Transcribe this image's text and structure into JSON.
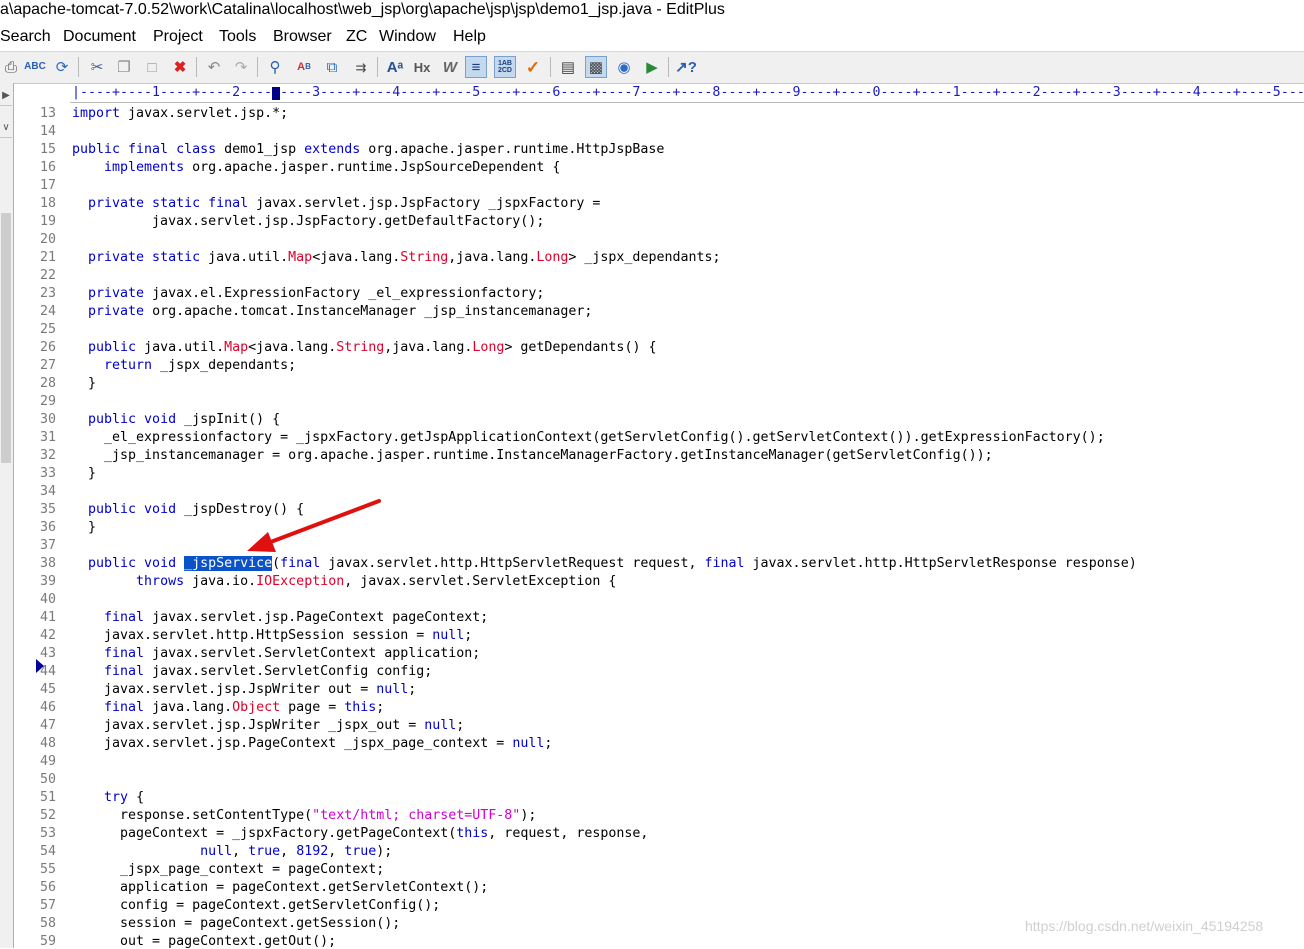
{
  "window": {
    "title": "a\\apache-tomcat-7.0.52\\work\\Catalina\\localhost\\web_jsp\\org\\apache\\jsp\\jsp\\demo1_jsp.java - EditPlus"
  },
  "menu": [
    "Search",
    "Document",
    "Project",
    "Tools",
    "Browser",
    "ZC",
    "Window",
    "Help"
  ],
  "toolbar": {
    "icons": [
      "print-icon",
      "spellcheck-icon",
      "refresh-icon",
      "cut-icon",
      "copy-icon",
      "paste-icon",
      "delete-icon",
      "undo-icon",
      "redo-icon",
      "find-icon",
      "replace-icon",
      "find-in-files-icon",
      "goto-line-icon",
      "font-icon",
      "hex-icon",
      "word-wrap-icon",
      "line-numbers-icon",
      "column-select-icon",
      "spellcheck-tick-icon",
      "fullscreen-icon",
      "output-window-icon",
      "browser-icon",
      "run-icon",
      "help-icon"
    ],
    "colors": {
      "accent": "#0a52c8",
      "keyword": "#0000cc",
      "type_highlight": "#e0002a",
      "string": "#d400d4",
      "line_number": "#7a7a7a"
    }
  },
  "ruler": {
    "text": "|----+----1----+----2----+----3----+----4----+----5----+----6----+----7----+----8----+----9----+----0----+----1----+----2----+----3----+----4----+----5----"
  },
  "editor": {
    "current_line": "38",
    "selected_text": "_jspService",
    "lines": [
      {
        "n": "13",
        "segs": [
          {
            "t": "import",
            "c": "kw"
          },
          {
            "t": " javax.servlet.jsp.*;"
          }
        ]
      },
      {
        "n": "14",
        "segs": []
      },
      {
        "n": "15",
        "segs": [
          {
            "t": "public final class",
            "c": "kw"
          },
          {
            "t": " demo1_jsp "
          },
          {
            "t": "extends",
            "c": "kw"
          },
          {
            "t": " org.apache.jasper.runtime.HttpJspBase"
          }
        ]
      },
      {
        "n": "16",
        "segs": [
          {
            "t": "    "
          },
          {
            "t": "implements",
            "c": "kw"
          },
          {
            "t": " org.apache.jasper.runtime.JspSourceDependent {"
          }
        ]
      },
      {
        "n": "17",
        "segs": []
      },
      {
        "n": "18",
        "segs": [
          {
            "t": "  "
          },
          {
            "t": "private static final",
            "c": "kw"
          },
          {
            "t": " javax.servlet.jsp.JspFactory _jspxFactory ="
          }
        ]
      },
      {
        "n": "19",
        "segs": [
          {
            "t": "          javax.servlet.jsp.JspFactory.getDefaultFactory();"
          }
        ]
      },
      {
        "n": "20",
        "segs": []
      },
      {
        "n": "21",
        "segs": [
          {
            "t": "  "
          },
          {
            "t": "private static",
            "c": "kw"
          },
          {
            "t": " java.util."
          },
          {
            "t": "Map",
            "c": "rd"
          },
          {
            "t": "<java.lang."
          },
          {
            "t": "String",
            "c": "rd"
          },
          {
            "t": ",java.lang."
          },
          {
            "t": "Long",
            "c": "rd"
          },
          {
            "t": "> _jspx_dependants;"
          }
        ]
      },
      {
        "n": "22",
        "segs": []
      },
      {
        "n": "23",
        "segs": [
          {
            "t": "  "
          },
          {
            "t": "private",
            "c": "kw"
          },
          {
            "t": " javax.el.ExpressionFactory _el_expressionfactory;"
          }
        ]
      },
      {
        "n": "24",
        "segs": [
          {
            "t": "  "
          },
          {
            "t": "private",
            "c": "kw"
          },
          {
            "t": " org.apache.tomcat.InstanceManager _jsp_instancemanager;"
          }
        ]
      },
      {
        "n": "25",
        "segs": []
      },
      {
        "n": "26",
        "segs": [
          {
            "t": "  "
          },
          {
            "t": "public",
            "c": "kw"
          },
          {
            "t": " java.util."
          },
          {
            "t": "Map",
            "c": "rd"
          },
          {
            "t": "<java.lang."
          },
          {
            "t": "String",
            "c": "rd"
          },
          {
            "t": ",java.lang."
          },
          {
            "t": "Long",
            "c": "rd"
          },
          {
            "t": "> getDependants() {"
          }
        ]
      },
      {
        "n": "27",
        "segs": [
          {
            "t": "    "
          },
          {
            "t": "return",
            "c": "kw"
          },
          {
            "t": " _jspx_dependants;"
          }
        ]
      },
      {
        "n": "28",
        "segs": [
          {
            "t": "  }"
          }
        ]
      },
      {
        "n": "29",
        "segs": []
      },
      {
        "n": "30",
        "segs": [
          {
            "t": "  "
          },
          {
            "t": "public void",
            "c": "kw"
          },
          {
            "t": " _jspInit() {"
          }
        ]
      },
      {
        "n": "31",
        "segs": [
          {
            "t": "    _el_expressionfactory = _jspxFactory.getJspApplicationContext(getServletConfig().getServletContext()).getExpressionFactory();"
          }
        ]
      },
      {
        "n": "32",
        "segs": [
          {
            "t": "    _jsp_instancemanager = org.apache.jasper.runtime.InstanceManagerFactory.getInstanceManager(getServletConfig());"
          }
        ]
      },
      {
        "n": "33",
        "segs": [
          {
            "t": "  }"
          }
        ]
      },
      {
        "n": "34",
        "segs": []
      },
      {
        "n": "35",
        "segs": [
          {
            "t": "  "
          },
          {
            "t": "public void",
            "c": "kw"
          },
          {
            "t": " _jspDestroy() {"
          }
        ]
      },
      {
        "n": "36",
        "segs": [
          {
            "t": "  }"
          }
        ]
      },
      {
        "n": "37",
        "segs": []
      },
      {
        "n": "38",
        "segs": [
          {
            "t": "  "
          },
          {
            "t": "public void",
            "c": "kw"
          },
          {
            "t": " "
          },
          {
            "t": "_jspService",
            "c": "sel"
          },
          {
            "t": "("
          },
          {
            "t": "final",
            "c": "kw"
          },
          {
            "t": " javax.servlet.http.HttpServletRequest request, "
          },
          {
            "t": "final",
            "c": "kw"
          },
          {
            "t": " javax.servlet.http.HttpServletResponse response)"
          }
        ]
      },
      {
        "n": "39",
        "segs": [
          {
            "t": "        "
          },
          {
            "t": "throws",
            "c": "kw"
          },
          {
            "t": " java.io."
          },
          {
            "t": "IOException",
            "c": "rd"
          },
          {
            "t": ", javax.servlet.ServletException {"
          }
        ]
      },
      {
        "n": "40",
        "segs": []
      },
      {
        "n": "41",
        "segs": [
          {
            "t": "    "
          },
          {
            "t": "final",
            "c": "kw"
          },
          {
            "t": " javax.servlet.jsp.PageContext pageContext;"
          }
        ]
      },
      {
        "n": "42",
        "segs": [
          {
            "t": "    javax.servlet.http.HttpSession session = "
          },
          {
            "t": "null",
            "c": "kw"
          },
          {
            "t": ";"
          }
        ]
      },
      {
        "n": "43",
        "segs": [
          {
            "t": "    "
          },
          {
            "t": "final",
            "c": "kw"
          },
          {
            "t": " javax.servlet.ServletContext application;"
          }
        ]
      },
      {
        "n": "44",
        "segs": [
          {
            "t": "    "
          },
          {
            "t": "final",
            "c": "kw"
          },
          {
            "t": " javax.servlet.ServletConfig config;"
          }
        ]
      },
      {
        "n": "45",
        "segs": [
          {
            "t": "    javax.servlet.jsp.JspWriter out = "
          },
          {
            "t": "null",
            "c": "kw"
          },
          {
            "t": ";"
          }
        ]
      },
      {
        "n": "46",
        "segs": [
          {
            "t": "    "
          },
          {
            "t": "final",
            "c": "kw"
          },
          {
            "t": " java.lang."
          },
          {
            "t": "Object",
            "c": "rd"
          },
          {
            "t": " page = "
          },
          {
            "t": "this",
            "c": "kw"
          },
          {
            "t": ";"
          }
        ]
      },
      {
        "n": "47",
        "segs": [
          {
            "t": "    javax.servlet.jsp.JspWriter _jspx_out = "
          },
          {
            "t": "null",
            "c": "kw"
          },
          {
            "t": ";"
          }
        ]
      },
      {
        "n": "48",
        "segs": [
          {
            "t": "    javax.servlet.jsp.PageContext _jspx_page_context = "
          },
          {
            "t": "null",
            "c": "kw"
          },
          {
            "t": ";"
          }
        ]
      },
      {
        "n": "49",
        "segs": []
      },
      {
        "n": "50",
        "segs": []
      },
      {
        "n": "51",
        "segs": [
          {
            "t": "    "
          },
          {
            "t": "try",
            "c": "kw"
          },
          {
            "t": " {"
          }
        ]
      },
      {
        "n": "52",
        "segs": [
          {
            "t": "      response.setContentType("
          },
          {
            "t": "\"text/html; charset=UTF-8\"",
            "c": "str"
          },
          {
            "t": ");"
          }
        ]
      },
      {
        "n": "53",
        "segs": [
          {
            "t": "      pageContext = _jspxFactory.getPageContext("
          },
          {
            "t": "this",
            "c": "kw"
          },
          {
            "t": ", request, response,"
          }
        ]
      },
      {
        "n": "54",
        "segs": [
          {
            "t": "                "
          },
          {
            "t": "null",
            "c": "kw"
          },
          {
            "t": ", "
          },
          {
            "t": "true",
            "c": "kw"
          },
          {
            "t": ", "
          },
          {
            "t": "8192",
            "c": "kw"
          },
          {
            "t": ", "
          },
          {
            "t": "true",
            "c": "kw"
          },
          {
            "t": ");"
          }
        ]
      },
      {
        "n": "55",
        "segs": [
          {
            "t": "      _jspx_page_context = pageContext;"
          }
        ]
      },
      {
        "n": "56",
        "segs": [
          {
            "t": "      application = pageContext.getServletContext();"
          }
        ]
      },
      {
        "n": "57",
        "segs": [
          {
            "t": "      config = pageContext.getServletConfig();"
          }
        ]
      },
      {
        "n": "58",
        "segs": [
          {
            "t": "      session = pageContext.getSession();"
          }
        ]
      },
      {
        "n": "59",
        "segs": [
          {
            "t": "      out = pageContext.getOut();"
          }
        ]
      }
    ]
  },
  "watermark": "https://blog.csdn.net/weixin_45194258"
}
